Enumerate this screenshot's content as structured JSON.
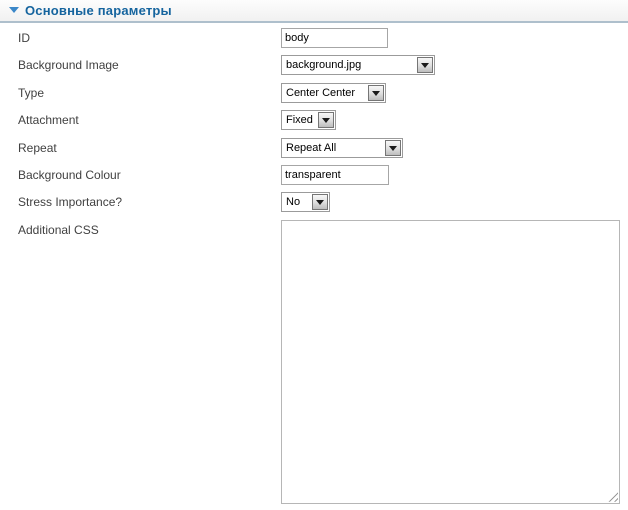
{
  "panel": {
    "title": "Основные параметры",
    "state": "expanded"
  },
  "icons": {
    "collapse_toggle": "triangle-down-icon",
    "combo_arrow": "triangle-down-icon",
    "resize_handle": "resize-grip-icon"
  },
  "colors": {
    "title_blue": "#15649e",
    "triangle_blue": "#3b87c8",
    "header_border": "#aebfcc",
    "input_border": "#a6a6a6",
    "combo_border": "#9b9b9b",
    "label_text": "#414141",
    "field_text": "#000000"
  },
  "form": {
    "fields": [
      {
        "label": "ID",
        "type": "text",
        "value": "body"
      },
      {
        "label": "Background Image",
        "type": "select",
        "value": "background.jpg"
      },
      {
        "label": "Type",
        "type": "select",
        "value": "Center Center"
      },
      {
        "label": "Attachment",
        "type": "select",
        "value": "Fixed"
      },
      {
        "label": "Repeat",
        "type": "select",
        "value": "Repeat All"
      },
      {
        "label": "Background Colour",
        "type": "text",
        "value": "transparent"
      },
      {
        "label": "Stress Importance?",
        "type": "select",
        "value": "No"
      },
      {
        "label": "Additional CSS",
        "type": "textarea",
        "value": ""
      }
    ]
  }
}
